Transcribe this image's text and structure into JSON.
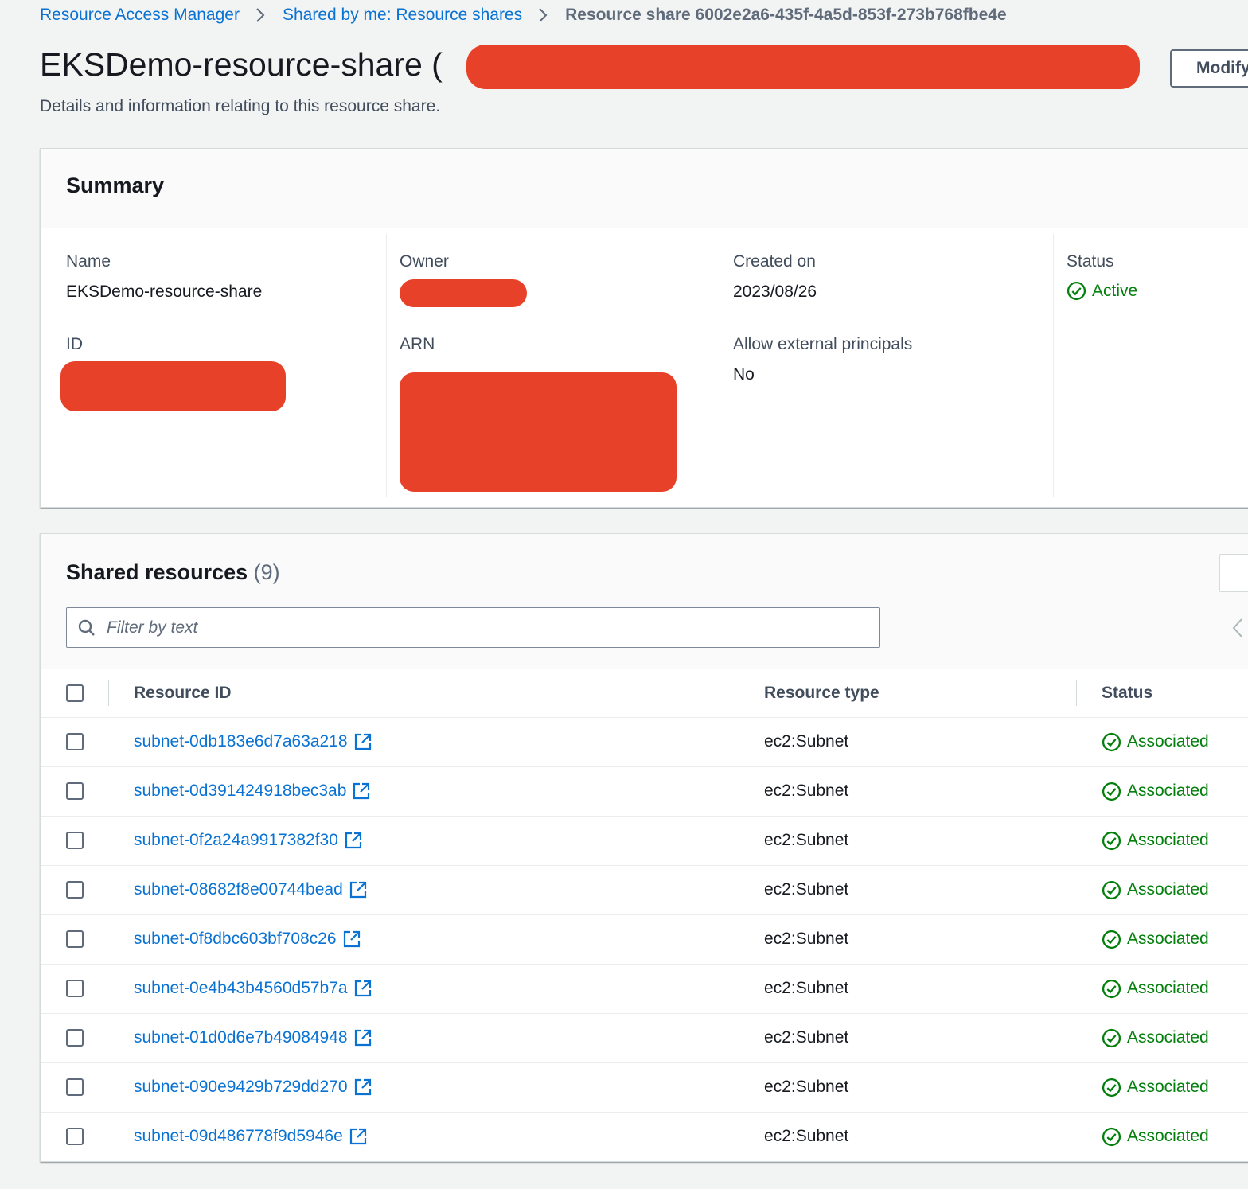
{
  "breadcrumb": {
    "items": [
      "Resource Access Manager",
      "Shared by me: Resource shares"
    ],
    "current": "Resource share 6002e2a6-435f-4a5d-853f-273b768fbe4e"
  },
  "header": {
    "title_prefix": "EKSDemo-resource-share (",
    "title_suffix": ")",
    "modify_label": "Modify",
    "subtitle": "Details and information relating to this resource share."
  },
  "summary": {
    "title": "Summary",
    "name_label": "Name",
    "name_value": "EKSDemo-resource-share",
    "id_label": "ID",
    "owner_label": "Owner",
    "arn_label": "ARN",
    "created_label": "Created on",
    "created_value": "2023/08/26",
    "external_label": "Allow external principals",
    "external_value": "No",
    "status_label": "Status",
    "status_value": "Active"
  },
  "resources": {
    "title": "Shared resources",
    "count": "(9)",
    "filter_placeholder": "Filter by text",
    "columns": [
      "Resource ID",
      "Resource type",
      "Status"
    ],
    "rows": [
      {
        "id": "subnet-0db183e6d7a63a218",
        "type": "ec2:Subnet",
        "status": "Associated"
      },
      {
        "id": "subnet-0d391424918bec3ab",
        "type": "ec2:Subnet",
        "status": "Associated"
      },
      {
        "id": "subnet-0f2a24a9917382f30",
        "type": "ec2:Subnet",
        "status": "Associated"
      },
      {
        "id": "subnet-08682f8e00744bead",
        "type": "ec2:Subnet",
        "status": "Associated"
      },
      {
        "id": "subnet-0f8dbc603bf708c26",
        "type": "ec2:Subnet",
        "status": "Associated"
      },
      {
        "id": "subnet-0e4b43b4560d57b7a",
        "type": "ec2:Subnet",
        "status": "Associated"
      },
      {
        "id": "subnet-01d0d6e7b49084948",
        "type": "ec2:Subnet",
        "status": "Associated"
      },
      {
        "id": "subnet-090e9429b729dd270",
        "type": "ec2:Subnet",
        "status": "Associated"
      },
      {
        "id": "subnet-09d486778f9d5946e",
        "type": "ec2:Subnet",
        "status": "Associated"
      }
    ]
  },
  "colors": {
    "link": "#0972d3",
    "success": "#037f0c",
    "redaction": "#e8412a",
    "background": "#f2f3f3"
  },
  "icons": [
    "chevron-right-icon",
    "search-icon",
    "external-link-icon",
    "status-success-icon",
    "chevron-left-icon"
  ]
}
